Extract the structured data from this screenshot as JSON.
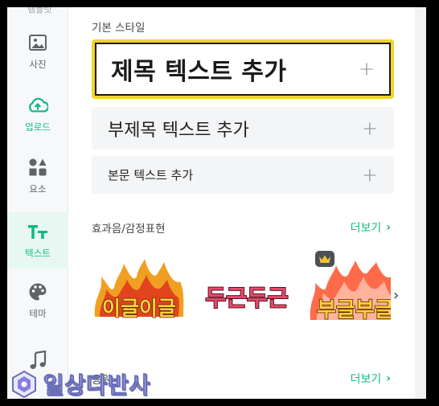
{
  "sidebar": {
    "top_cut_label": "템플릿",
    "items": [
      {
        "label": "사진",
        "icon": "image-icon"
      },
      {
        "label": "업로드",
        "icon": "cloud-upload-icon"
      },
      {
        "label": "요소",
        "icon": "shapes-icon"
      },
      {
        "label": "텍스트",
        "icon": "text-tt-icon"
      },
      {
        "label": "테마",
        "icon": "palette-icon"
      },
      {
        "label": "",
        "icon": "music-icon"
      }
    ]
  },
  "main": {
    "basic_style_title": "기본 스타일",
    "cards": {
      "title": "제목 텍스트 추가",
      "subtitle": "부제목 텍스트 추가",
      "body": "본문 텍스트 추가",
      "plus": "+"
    },
    "effects_section": {
      "title": "효과음/감정표현",
      "more": "더보기",
      "stickers": [
        "이글이글",
        "두근두근",
        "부글부글"
      ]
    },
    "next_section": {
      "title": "응원",
      "more": "더보기"
    }
  },
  "watermark": "일상다반사",
  "colors": {
    "accent": "#12b886",
    "highlight_border": "#f2d32a",
    "sidebar_bg": "#f7f8f9",
    "card_bg": "#f4f5f7"
  }
}
